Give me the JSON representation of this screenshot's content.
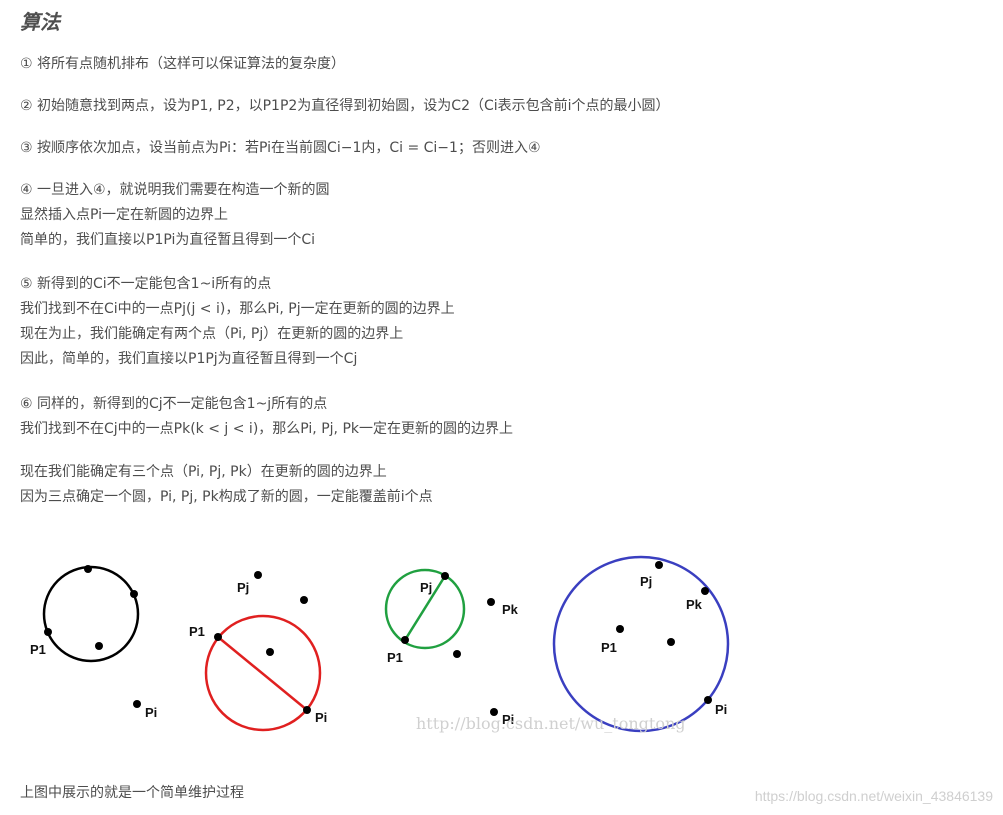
{
  "title": "算法",
  "step1": {
    "text": "① 将所有点随机排布（这样可以保证算法的复杂度）"
  },
  "step2": {
    "text": "② 初始随意找到两点，设为P1, P2，以P1P2为直径得到初始圆，设为C2（Ci表示包含前i个点的最小圆）"
  },
  "step3": {
    "text": "③ 按顺序依次加点，设当前点为Pi：若Pi在当前圆Ci−1内，Ci = Ci−1；否则进入④"
  },
  "step4": {
    "lines": [
      "④ 一旦进入④，就说明我们需要在构造一个新的圆",
      "显然插入点Pi一定在新圆的边界上",
      "简单的，我们直接以P1Pi为直径暂且得到一个Ci"
    ]
  },
  "step5": {
    "lines": [
      "⑤ 新得到的Ci不一定能包含1~i所有的点",
      "我们找到不在Ci中的一点Pj(j < i)，那么Pi, Pj一定在更新的圆的边界上",
      "现在为止，我们能确定有两个点（Pi, Pj）在更新的圆的边界上",
      "因此，简单的，我们直接以P1Pj为直径暂且得到一个Cj"
    ]
  },
  "step6": {
    "lines": [
      "⑥ 同样的，新得到的Cj不一定能包含1~j所有的点",
      "我们找到不在Cj中的一点Pk(k < j < i)，那么Pi, Pj, Pk一定在更新的圆的边界上"
    ]
  },
  "step7": {
    "lines": [
      "现在我们能确定有三个点（Pi, Pj, Pk）在更新的圆的边界上",
      "因为三点确定一个圆，Pi, Pj, Pk构成了新的圆，一定能覆盖前i个点"
    ]
  },
  "figure": {
    "labels": {
      "p1_a": "P1",
      "pi_a": "Pi",
      "pj_b": "Pj",
      "p1_b": "P1",
      "pi_b": "Pi",
      "pj_c": "Pj",
      "pk_c": "Pk",
      "p1_c": "P1",
      "pi_c": "Pi",
      "pj_d": "Pj",
      "pk_d": "Pk",
      "p1_d": "P1",
      "pi_d": "Pi"
    },
    "colors": {
      "circle1": "#000000",
      "circle2": "#e02020",
      "circle3": "#20a040",
      "circle4": "#3a3fc0"
    },
    "watermark": "http://blog.csdn.net/wu_tongtong"
  },
  "caption": "上图中展示的就是一个简单维护过程",
  "footer_watermark": "https://blog.csdn.net/weixin_43846139"
}
